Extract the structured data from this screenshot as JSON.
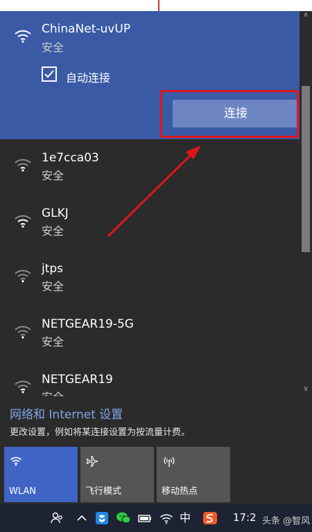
{
  "selected_network": {
    "name": "ChinaNet-uvUP",
    "status": "安全",
    "auto_connect_label": "自动连接",
    "auto_connect_checked": true,
    "connect_label": "连接"
  },
  "networks": [
    {
      "name": "1e7cca03",
      "status": "安全"
    },
    {
      "name": "GLKJ",
      "status": "安全"
    },
    {
      "name": "jtps",
      "status": "安全"
    },
    {
      "name": "NETGEAR19-5G",
      "status": "安全"
    },
    {
      "name": "NETGEAR19",
      "status": "安全"
    }
  ],
  "settings": {
    "link_label": "网络和 Internet 设置",
    "description": "更改设置，例如将某连接设置为按流量计费。"
  },
  "quick_actions": [
    {
      "label": "WLAN",
      "icon": "wifi-icon",
      "active": true
    },
    {
      "label": "飞行模式",
      "icon": "airplane-icon",
      "active": false
    },
    {
      "label": "移动热点",
      "icon": "hotspot-icon",
      "active": false
    }
  ],
  "taskbar": {
    "time": "17:2",
    "ime_label": "中",
    "watermark": "头条 @智风"
  },
  "colors": {
    "selected_bg": "#3a5aa6",
    "accent": "#3f64c5",
    "highlight": "#e0151b",
    "link": "#7fa6e6"
  }
}
